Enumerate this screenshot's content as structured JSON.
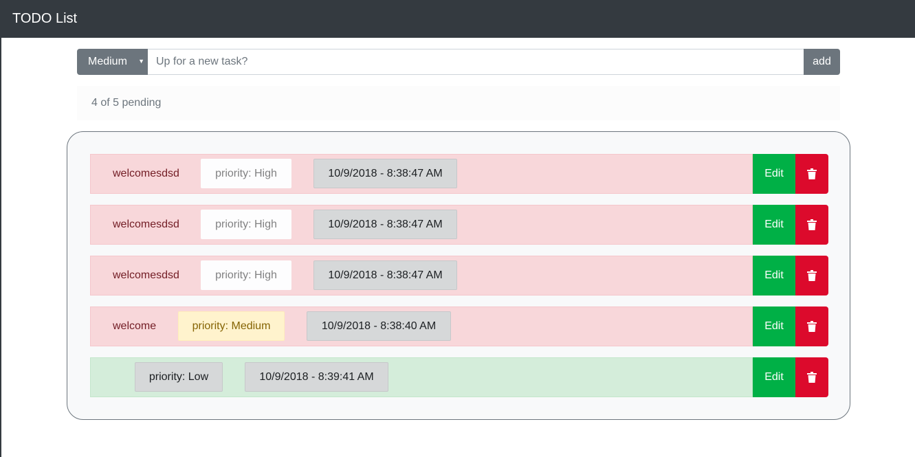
{
  "navbar": {
    "title": "TODO List"
  },
  "add_form": {
    "priority_selected": "Medium",
    "input_placeholder": "Up for a new task?",
    "input_value": "",
    "add_label": "add"
  },
  "status": {
    "pending_text": "4 of 5 pending"
  },
  "todos": [
    {
      "text": "welcomesdsd",
      "priority": "priority: High",
      "date": "10/9/2018 - 8:38:47 AM",
      "edit_label": "Edit",
      "delete_icon": "trash-icon"
    },
    {
      "text": "welcomesdsd",
      "priority": "priority: High",
      "date": "10/9/2018 - 8:38:47 AM",
      "edit_label": "Edit",
      "delete_icon": "trash-icon"
    },
    {
      "text": "welcomesdsd",
      "priority": "priority: High",
      "date": "10/9/2018 - 8:38:47 AM",
      "edit_label": "Edit",
      "delete_icon": "trash-icon"
    },
    {
      "text": "welcome",
      "priority": "priority: Medium",
      "date": "10/9/2018 - 8:38:40 AM",
      "edit_label": "Edit",
      "delete_icon": "trash-icon"
    },
    {
      "text": "",
      "priority": "priority: Low",
      "date": "10/9/2018 - 8:39:41 AM",
      "edit_label": "Edit",
      "delete_icon": "trash-icon"
    }
  ],
  "colors": {
    "navbar": "#343a40",
    "pending_row": "#f8d7da",
    "done_row": "#d4edda",
    "edit_button": "#00b046",
    "delete_button": "#dc0a2c",
    "add_button": "#6c757d"
  }
}
